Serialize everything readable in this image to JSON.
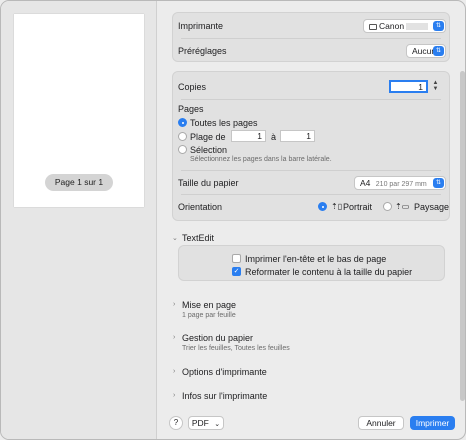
{
  "preview": {
    "page_indicator": "Page 1 sur 1"
  },
  "printer": {
    "label": "Imprimante",
    "value": "Canon"
  },
  "presets": {
    "label": "Préréglages",
    "value": "Aucun"
  },
  "copies": {
    "label": "Copies",
    "value": "1"
  },
  "pages": {
    "label": "Pages",
    "all_label": "Toutes les pages",
    "range_label": "Plage de",
    "range_from": "1",
    "range_to_label": "à",
    "range_to": "1",
    "selection_label": "Sélection",
    "selection_hint": "Sélectionnez les pages dans la barre latérale."
  },
  "paper_size": {
    "label": "Taille du papier",
    "value": "A4",
    "detail": "210 par 297 mm"
  },
  "orientation": {
    "label": "Orientation",
    "portrait": "Portrait",
    "landscape": "Paysage"
  },
  "textedit": {
    "title": "TextEdit",
    "header_footer": "Imprimer l'en-tête et le bas de page",
    "rewrap": "Reformater le contenu à la taille du papier"
  },
  "sections": [
    {
      "title": "Mise en page",
      "subtitle": "1 page par feuille"
    },
    {
      "title": "Gestion du papier",
      "subtitle": "Trier les feuilles, Toutes les feuilles"
    },
    {
      "title": "Options d'imprimante",
      "subtitle": ""
    },
    {
      "title": "Infos sur l'imprimante",
      "subtitle": ""
    }
  ],
  "footer": {
    "help": "?",
    "pdf": "PDF",
    "cancel": "Annuler",
    "print": "Imprimer"
  },
  "colors": {
    "accent": "#2a7ef0"
  }
}
